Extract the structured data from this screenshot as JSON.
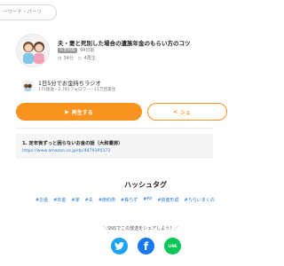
{
  "search": {
    "placeholder": "ーワード・パーソ"
  },
  "episode": {
    "title": "夫・妻と死別した場合の遺族年金のもらい方のコツ",
    "category_badge": "年金制度",
    "date": "94日前",
    "duration": "34分",
    "plays": "4再生"
  },
  "channel": {
    "name": "1日5分でお金持ちラジオ",
    "stats": "171放送・2,781フォロワー・11万回再生"
  },
  "buttons": {
    "play_label": "再生する",
    "share_label": "シェ"
  },
  "notes": {
    "title": "1. 定年後ずっと困らないお金の話（大和書房）",
    "link": "https://www.amazon.co.jp/dp/4479395172"
  },
  "hashtags": {
    "heading": "ハッシュタグ",
    "tags": [
      "#お金",
      "#年金",
      "#家",
      "#夫",
      "#節約術",
      "#株ちず",
      "#FP",
      "#資産形成",
      "#ちらいまくの"
    ]
  },
  "share": {
    "prompt": "＼SNSでこの放送をシェアしよう！／"
  },
  "colors": {
    "accent": "#f7931e",
    "link": "#2a7ad5",
    "twitter": "#1da1f2",
    "facebook": "#1877f2",
    "line": "#06c755"
  }
}
